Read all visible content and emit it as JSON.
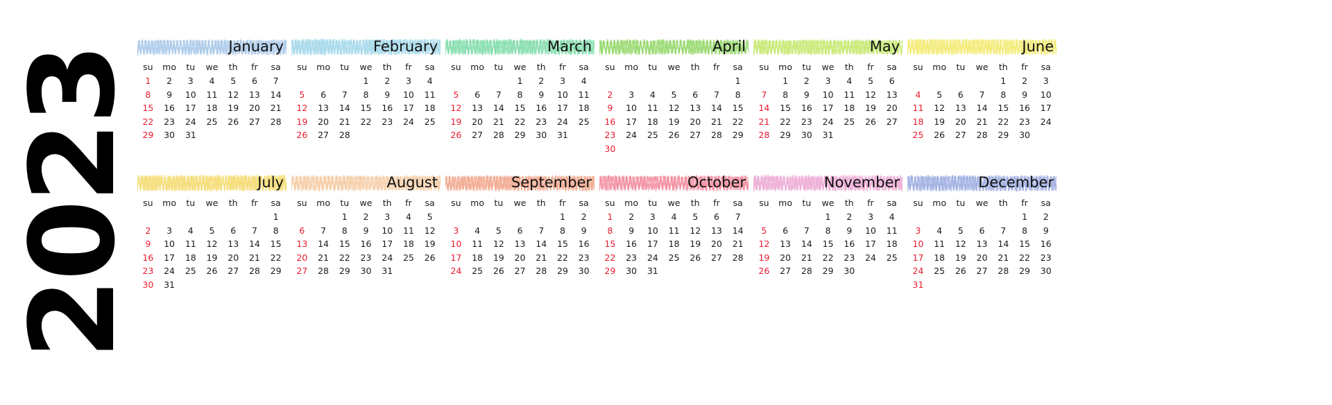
{
  "year": "2023",
  "weekday_headers": [
    "su",
    "mo",
    "tu",
    "we",
    "th",
    "fr",
    "sa"
  ],
  "colors": {
    "sunday_text": "#e8192c",
    "day_text": "#1a1a1a",
    "year_text": "#000000",
    "background": "#ffffff"
  },
  "months": [
    {
      "name": "January",
      "highlight_color": "#a8c8e8",
      "first_weekday_index": 0,
      "days_in_month": 31,
      "weeks": [
        [
          "1",
          "2",
          "3",
          "4",
          "5",
          "6",
          "7"
        ],
        [
          "8",
          "9",
          "10",
          "11",
          "12",
          "13",
          "14"
        ],
        [
          "15",
          "16",
          "17",
          "18",
          "19",
          "20",
          "21"
        ],
        [
          "22",
          "23",
          "24",
          "25",
          "26",
          "27",
          "28"
        ],
        [
          "29",
          "30",
          "31",
          "",
          "",
          "",
          ""
        ]
      ]
    },
    {
      "name": "February",
      "highlight_color": "#a5d8ea",
      "first_weekday_index": 3,
      "days_in_month": 28,
      "weeks": [
        [
          "",
          "",
          "",
          "1",
          "2",
          "3",
          "4"
        ],
        [
          "5",
          "6",
          "7",
          "8",
          "9",
          "10",
          "11"
        ],
        [
          "12",
          "13",
          "14",
          "15",
          "16",
          "17",
          "18"
        ],
        [
          "19",
          "20",
          "21",
          "22",
          "23",
          "24",
          "25"
        ],
        [
          "26",
          "27",
          "28",
          "",
          "",
          "",
          ""
        ]
      ]
    },
    {
      "name": "March",
      "highlight_color": "#7ddba8",
      "first_weekday_index": 3,
      "days_in_month": 31,
      "weeks": [
        [
          "",
          "",
          "",
          "1",
          "2",
          "3",
          "4"
        ],
        [
          "5",
          "6",
          "7",
          "8",
          "9",
          "10",
          "11"
        ],
        [
          "12",
          "13",
          "14",
          "15",
          "16",
          "17",
          "18"
        ],
        [
          "19",
          "20",
          "21",
          "22",
          "23",
          "24",
          "25"
        ],
        [
          "26",
          "27",
          "28",
          "29",
          "30",
          "31",
          ""
        ]
      ]
    },
    {
      "name": "April",
      "highlight_color": "#94d86a",
      "first_weekday_index": 6,
      "days_in_month": 30,
      "weeks": [
        [
          "",
          "",
          "",
          "",
          "",
          "",
          "1"
        ],
        [
          "2",
          "3",
          "4",
          "5",
          "6",
          "7",
          "8"
        ],
        [
          "9",
          "10",
          "11",
          "12",
          "13",
          "14",
          "15"
        ],
        [
          "16",
          "17",
          "18",
          "19",
          "20",
          "21",
          "22"
        ],
        [
          "23",
          "24",
          "25",
          "26",
          "27",
          "28",
          "29"
        ],
        [
          "30",
          "",
          "",
          "",
          "",
          "",
          ""
        ]
      ]
    },
    {
      "name": "May",
      "highlight_color": "#c3e86a",
      "first_weekday_index": 1,
      "days_in_month": 31,
      "weeks": [
        [
          "",
          "1",
          "2",
          "3",
          "4",
          "5",
          "6"
        ],
        [
          "7",
          "8",
          "9",
          "10",
          "11",
          "12",
          "13"
        ],
        [
          "14",
          "15",
          "16",
          "17",
          "18",
          "19",
          "20"
        ],
        [
          "21",
          "22",
          "23",
          "24",
          "25",
          "26",
          "27"
        ],
        [
          "28",
          "29",
          "30",
          "31",
          "",
          "",
          ""
        ]
      ]
    },
    {
      "name": "June",
      "highlight_color": "#f2e96b",
      "first_weekday_index": 4,
      "days_in_month": 30,
      "weeks": [
        [
          "",
          "",
          "",
          "",
          "1",
          "2",
          "3"
        ],
        [
          "4",
          "5",
          "6",
          "7",
          "8",
          "9",
          "10"
        ],
        [
          "11",
          "12",
          "13",
          "14",
          "15",
          "16",
          "17"
        ],
        [
          "18",
          "19",
          "20",
          "21",
          "22",
          "23",
          "24"
        ],
        [
          "25",
          "26",
          "27",
          "28",
          "29",
          "30",
          ""
        ]
      ]
    },
    {
      "name": "July",
      "highlight_color": "#f5dd78",
      "first_weekday_index": 6,
      "days_in_month": 31,
      "weeks": [
        [
          "",
          "",
          "",
          "",
          "",
          "",
          "1"
        ],
        [
          "2",
          "3",
          "4",
          "5",
          "6",
          "7",
          "8"
        ],
        [
          "9",
          "10",
          "11",
          "12",
          "13",
          "14",
          "15"
        ],
        [
          "16",
          "17",
          "18",
          "19",
          "20",
          "21",
          "22"
        ],
        [
          "23",
          "24",
          "25",
          "26",
          "27",
          "28",
          "29"
        ],
        [
          "30",
          "31",
          "",
          "",
          "",
          "",
          ""
        ]
      ]
    },
    {
      "name": "August",
      "highlight_color": "#f5c9a0",
      "first_weekday_index": 2,
      "days_in_month": 31,
      "weeks": [
        [
          "",
          "",
          "1",
          "2",
          "3",
          "4",
          "5"
        ],
        [
          "6",
          "7",
          "8",
          "9",
          "10",
          "11",
          "12"
        ],
        [
          "13",
          "14",
          "15",
          "16",
          "17",
          "18",
          "19"
        ],
        [
          "20",
          "21",
          "22",
          "23",
          "24",
          "25",
          "26"
        ],
        [
          "27",
          "28",
          "29",
          "30",
          "31",
          "",
          ""
        ]
      ]
    },
    {
      "name": "September",
      "highlight_color": "#f2a98f",
      "first_weekday_index": 5,
      "days_in_month": 30,
      "weeks": [
        [
          "",
          "",
          "",
          "",
          "",
          "1",
          "2"
        ],
        [
          "3",
          "4",
          "5",
          "6",
          "7",
          "8",
          "9"
        ],
        [
          "10",
          "11",
          "12",
          "13",
          "14",
          "15",
          "16"
        ],
        [
          "17",
          "18",
          "19",
          "20",
          "21",
          "22",
          "23"
        ],
        [
          "24",
          "25",
          "26",
          "27",
          "28",
          "29",
          "30"
        ]
      ]
    },
    {
      "name": "October",
      "highlight_color": "#f2889b",
      "first_weekday_index": 0,
      "days_in_month": 31,
      "weeks": [
        [
          "1",
          "2",
          "3",
          "4",
          "5",
          "6",
          "7"
        ],
        [
          "8",
          "9",
          "10",
          "11",
          "12",
          "13",
          "14"
        ],
        [
          "15",
          "16",
          "17",
          "18",
          "19",
          "20",
          "21"
        ],
        [
          "22",
          "23",
          "24",
          "25",
          "26",
          "27",
          "28"
        ],
        [
          "29",
          "30",
          "31",
          "",
          "",
          "",
          ""
        ]
      ]
    },
    {
      "name": "November",
      "highlight_color": "#eeaed6",
      "first_weekday_index": 3,
      "days_in_month": 30,
      "weeks": [
        [
          "",
          "",
          "",
          "1",
          "2",
          "3",
          "4"
        ],
        [
          "5",
          "6",
          "7",
          "8",
          "9",
          "10",
          "11"
        ],
        [
          "12",
          "13",
          "14",
          "15",
          "16",
          "17",
          "18"
        ],
        [
          "19",
          "20",
          "21",
          "22",
          "23",
          "24",
          "25"
        ],
        [
          "26",
          "27",
          "28",
          "29",
          "30",
          "",
          ""
        ]
      ]
    },
    {
      "name": "December",
      "highlight_color": "#9aaae0",
      "first_weekday_index": 5,
      "days_in_month": 31,
      "weeks": [
        [
          "",
          "",
          "",
          "",
          "",
          "1",
          "2"
        ],
        [
          "3",
          "4",
          "5",
          "6",
          "7",
          "8",
          "9"
        ],
        [
          "10",
          "11",
          "12",
          "13",
          "14",
          "15",
          "16"
        ],
        [
          "17",
          "18",
          "19",
          "20",
          "21",
          "22",
          "23"
        ],
        [
          "24",
          "25",
          "26",
          "27",
          "28",
          "29",
          "30"
        ],
        [
          "31",
          "",
          "",
          "",
          "",
          "",
          ""
        ]
      ]
    }
  ]
}
